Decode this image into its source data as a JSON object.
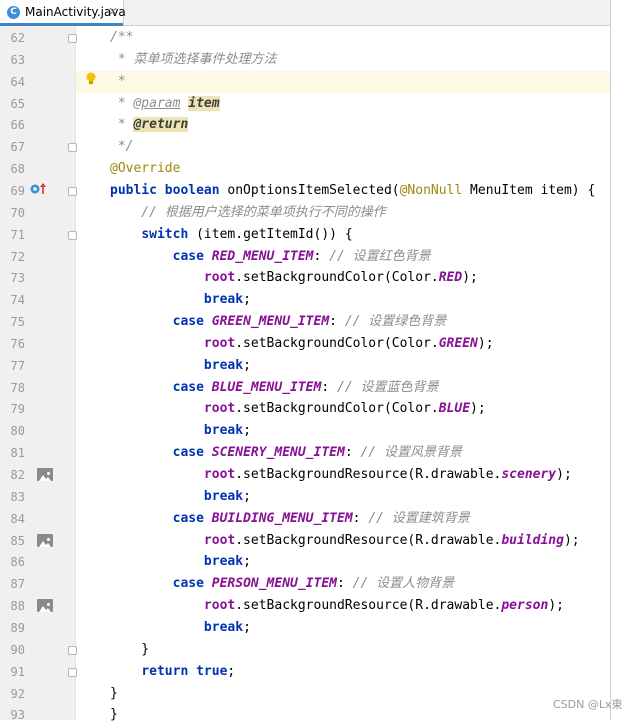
{
  "tab": {
    "icon_letter": "C",
    "file_name": "MainActivity.java",
    "close": "×"
  },
  "watermark": "CSDN @Lx東",
  "colors": {
    "keyword": "#0033b3",
    "comment": "#8c8c8c",
    "constant": "#871094",
    "annotation": "#9e880d",
    "tab_accent": "#4083c9"
  },
  "gutter_icons": [
    "lightbulb-icon",
    "override-method-icon",
    "image-resource-icon"
  ],
  "lines": [
    {
      "num": "62",
      "tokens": [
        {
          "t": "/**",
          "c": "cm"
        }
      ]
    },
    {
      "num": "63",
      "tokens": [
        {
          "t": " * 菜单项选择事件处理方法",
          "c": "cm"
        }
      ]
    },
    {
      "num": "64",
      "tokens": [
        {
          "t": " *",
          "c": "cm"
        }
      ]
    },
    {
      "num": "65",
      "tokens": [
        {
          "t": " * ",
          "c": "cm"
        },
        {
          "t": "@param",
          "c": "tag"
        },
        {
          "t": " ",
          "c": "cm"
        },
        {
          "t": "item",
          "c": "tagv"
        }
      ]
    },
    {
      "num": "66",
      "tokens": [
        {
          "t": " * ",
          "c": "cm"
        },
        {
          "t": "@return",
          "c": "tagv"
        }
      ]
    },
    {
      "num": "67",
      "tokens": [
        {
          "t": " */",
          "c": "cm"
        }
      ]
    },
    {
      "num": "68",
      "tokens": [
        {
          "t": "@Override",
          "c": "an"
        }
      ]
    },
    {
      "num": "69",
      "tokens": [
        {
          "t": "public boolean ",
          "c": "kw"
        },
        {
          "t": "onOptionsItemSelected(",
          "c": ""
        },
        {
          "t": "@NonNull",
          "c": "an"
        },
        {
          "t": " MenuItem item) {",
          "c": ""
        }
      ]
    },
    {
      "num": "70",
      "tokens": [
        {
          "t": "    // 根据用户选择的菜单项执行不同的操作",
          "c": "cm"
        }
      ]
    },
    {
      "num": "71",
      "tokens": [
        {
          "t": "    ",
          "c": ""
        },
        {
          "t": "switch",
          "c": "kw"
        },
        {
          "t": " (item.getItemId()) {",
          "c": ""
        }
      ]
    },
    {
      "num": "72",
      "tokens": [
        {
          "t": "        ",
          "c": ""
        },
        {
          "t": "case ",
          "c": "kw"
        },
        {
          "t": "RED_MENU_ITEM",
          "c": "ct"
        },
        {
          "t": ": ",
          "c": ""
        },
        {
          "t": "// 设置红色背景",
          "c": "cm"
        }
      ]
    },
    {
      "num": "73",
      "tokens": [
        {
          "t": "            ",
          "c": ""
        },
        {
          "t": "root",
          "c": "fd"
        },
        {
          "t": ".setBackgroundColor(Color.",
          "c": ""
        },
        {
          "t": "RED",
          "c": "ct"
        },
        {
          "t": ");",
          "c": ""
        }
      ]
    },
    {
      "num": "74",
      "tokens": [
        {
          "t": "            ",
          "c": ""
        },
        {
          "t": "break",
          "c": "kw"
        },
        {
          "t": ";",
          "c": ""
        }
      ]
    },
    {
      "num": "75",
      "tokens": [
        {
          "t": "        ",
          "c": ""
        },
        {
          "t": "case ",
          "c": "kw"
        },
        {
          "t": "GREEN_MENU_ITEM",
          "c": "ct"
        },
        {
          "t": ": ",
          "c": ""
        },
        {
          "t": "// 设置绿色背景",
          "c": "cm"
        }
      ]
    },
    {
      "num": "76",
      "tokens": [
        {
          "t": "            ",
          "c": ""
        },
        {
          "t": "root",
          "c": "fd"
        },
        {
          "t": ".setBackgroundColor(Color.",
          "c": ""
        },
        {
          "t": "GREEN",
          "c": "ct"
        },
        {
          "t": ");",
          "c": ""
        }
      ]
    },
    {
      "num": "77",
      "tokens": [
        {
          "t": "            ",
          "c": ""
        },
        {
          "t": "break",
          "c": "kw"
        },
        {
          "t": ";",
          "c": ""
        }
      ]
    },
    {
      "num": "78",
      "tokens": [
        {
          "t": "        ",
          "c": ""
        },
        {
          "t": "case ",
          "c": "kw"
        },
        {
          "t": "BLUE_MENU_ITEM",
          "c": "ct"
        },
        {
          "t": ": ",
          "c": ""
        },
        {
          "t": "// 设置蓝色背景",
          "c": "cm"
        }
      ]
    },
    {
      "num": "79",
      "tokens": [
        {
          "t": "            ",
          "c": ""
        },
        {
          "t": "root",
          "c": "fd"
        },
        {
          "t": ".setBackgroundColor(Color.",
          "c": ""
        },
        {
          "t": "BLUE",
          "c": "ct"
        },
        {
          "t": ");",
          "c": ""
        }
      ]
    },
    {
      "num": "80",
      "tokens": [
        {
          "t": "            ",
          "c": ""
        },
        {
          "t": "break",
          "c": "kw"
        },
        {
          "t": ";",
          "c": ""
        }
      ]
    },
    {
      "num": "81",
      "tokens": [
        {
          "t": "        ",
          "c": ""
        },
        {
          "t": "case ",
          "c": "kw"
        },
        {
          "t": "SCENERY_MENU_ITEM",
          "c": "ct"
        },
        {
          "t": ": ",
          "c": ""
        },
        {
          "t": "// 设置风景背景",
          "c": "cm"
        }
      ]
    },
    {
      "num": "82",
      "tokens": [
        {
          "t": "            ",
          "c": ""
        },
        {
          "t": "root",
          "c": "fd"
        },
        {
          "t": ".setBackgroundResource(R.drawable.",
          "c": ""
        },
        {
          "t": "scenery",
          "c": "ct"
        },
        {
          "t": ");",
          "c": ""
        }
      ]
    },
    {
      "num": "83",
      "tokens": [
        {
          "t": "            ",
          "c": ""
        },
        {
          "t": "break",
          "c": "kw"
        },
        {
          "t": ";",
          "c": ""
        }
      ]
    },
    {
      "num": "84",
      "tokens": [
        {
          "t": "        ",
          "c": ""
        },
        {
          "t": "case ",
          "c": "kw"
        },
        {
          "t": "BUILDING_MENU_ITEM",
          "c": "ct"
        },
        {
          "t": ": ",
          "c": ""
        },
        {
          "t": "// 设置建筑背景",
          "c": "cm"
        }
      ]
    },
    {
      "num": "85",
      "tokens": [
        {
          "t": "            ",
          "c": ""
        },
        {
          "t": "root",
          "c": "fd"
        },
        {
          "t": ".setBackgroundResource(R.drawable.",
          "c": ""
        },
        {
          "t": "building",
          "c": "ct"
        },
        {
          "t": ");",
          "c": ""
        }
      ]
    },
    {
      "num": "86",
      "tokens": [
        {
          "t": "            ",
          "c": ""
        },
        {
          "t": "break",
          "c": "kw"
        },
        {
          "t": ";",
          "c": ""
        }
      ]
    },
    {
      "num": "87",
      "tokens": [
        {
          "t": "        ",
          "c": ""
        },
        {
          "t": "case ",
          "c": "kw"
        },
        {
          "t": "PERSON_MENU_ITEM",
          "c": "ct"
        },
        {
          "t": ": ",
          "c": ""
        },
        {
          "t": "// 设置人物背景",
          "c": "cm"
        }
      ]
    },
    {
      "num": "88",
      "tokens": [
        {
          "t": "            ",
          "c": ""
        },
        {
          "t": "root",
          "c": "fd"
        },
        {
          "t": ".setBackgroundResource(R.drawable.",
          "c": ""
        },
        {
          "t": "person",
          "c": "ct"
        },
        {
          "t": ");",
          "c": ""
        }
      ]
    },
    {
      "num": "89",
      "tokens": [
        {
          "t": "            ",
          "c": ""
        },
        {
          "t": "break",
          "c": "kw"
        },
        {
          "t": ";",
          "c": ""
        }
      ]
    },
    {
      "num": "90",
      "tokens": [
        {
          "t": "    }",
          "c": ""
        }
      ]
    },
    {
      "num": "91",
      "tokens": [
        {
          "t": "    ",
          "c": ""
        },
        {
          "t": "return true",
          "c": "kw"
        },
        {
          "t": ";",
          "c": ""
        }
      ]
    },
    {
      "num": "92",
      "tokens": [
        {
          "t": "}",
          "c": ""
        }
      ]
    },
    {
      "num": "93",
      "tokens": [
        {
          "t": "}",
          "c": ""
        }
      ]
    }
  ]
}
